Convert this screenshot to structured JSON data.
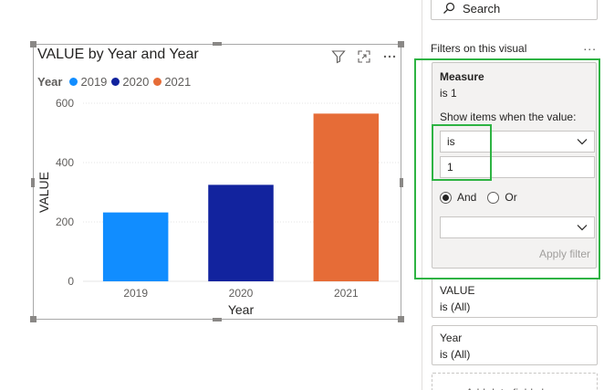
{
  "visual": {
    "title": "VALUE by Year and Year",
    "icons": [
      "filter-icon",
      "focus-mode-icon",
      "more-options-icon"
    ]
  },
  "legend": {
    "title": "Year",
    "items": [
      {
        "label": "2019",
        "color": "#118dff"
      },
      {
        "label": "2020",
        "color": "#12239e"
      },
      {
        "label": "2021",
        "color": "#e66c37"
      }
    ]
  },
  "chart_data": {
    "type": "bar",
    "categories": [
      "2019",
      "2020",
      "2021"
    ],
    "values": [
      232,
      325,
      565
    ],
    "colors": [
      "#118dff",
      "#12239e",
      "#e66c37"
    ],
    "xlabel": "Year",
    "ylabel": "VALUE",
    "ylim": [
      0,
      600
    ],
    "yticks": [
      0,
      200,
      400,
      600
    ],
    "grid": true,
    "legend_position": "top-left"
  },
  "filter_pane": {
    "search_placeholder": "Search",
    "section_title": "Filters on this visual",
    "more": "...",
    "measure_card": {
      "name": "Measure",
      "summary": "is 1",
      "show_items_label": "Show items when the value:",
      "condition_value": "is",
      "input_value": "1",
      "logic_and": "And",
      "logic_or": "Or",
      "logic_selected": "And",
      "second_condition_value": "",
      "apply_label": "Apply filter"
    },
    "cards": [
      {
        "name": "VALUE",
        "summary": "is (All)"
      },
      {
        "name": "Year",
        "summary": "is (All)"
      }
    ],
    "add_fields_label": "Add data fields here"
  },
  "colors": {
    "highlight_green": "#2eb343",
    "pane_card_bg": "#f3f2f1"
  }
}
